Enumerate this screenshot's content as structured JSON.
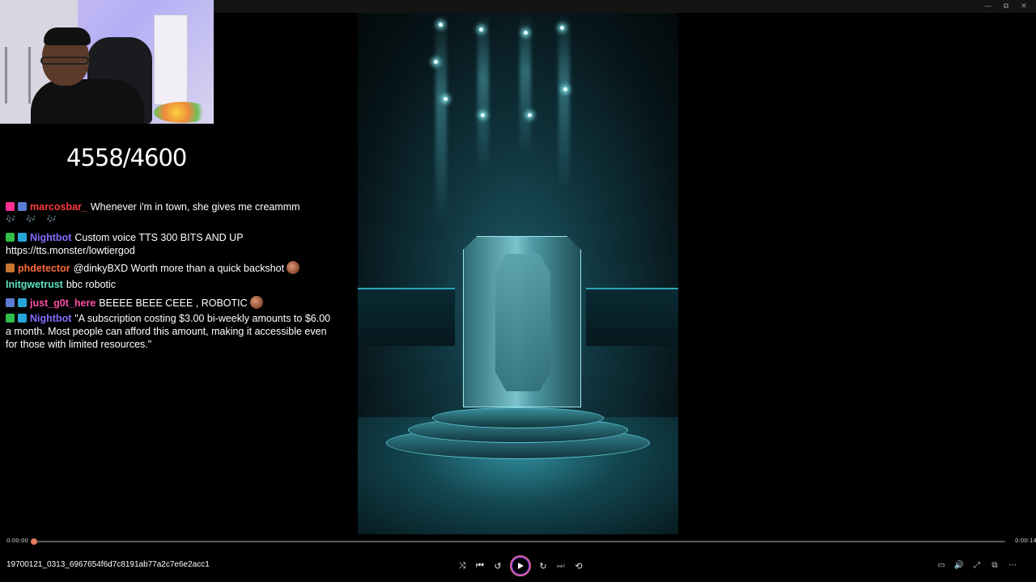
{
  "window": {
    "controls": [
      {
        "name": "minimize-button",
        "glyph": "—"
      },
      {
        "name": "restore-button",
        "glyph": "⧉"
      },
      {
        "name": "close-button",
        "glyph": "✕"
      }
    ]
  },
  "overlay": {
    "counter": "4558/4600"
  },
  "chat": {
    "messages": [
      {
        "user": "marcosbar_",
        "user_color": "#ff3b3b",
        "text": "Whenever i'm in town, she gives me creammm",
        "badges": [
          "#ff2f92",
          "#5b7bd6"
        ],
        "extra_line": "🎶 🎶 🎶"
      },
      {
        "user": "Nightbot",
        "user_color": "#8a6bff",
        "text": "Custom voice TTS 300 BITS AND UP https://tts.monster/lowtiergod",
        "badges": [
          "#2fbf4a",
          "#26a7d8"
        ]
      },
      {
        "user": "phdetector",
        "user_color": "#ff6b3b",
        "text": "@dinkyBXD Worth more than a quick backshot",
        "badges": [
          "#c8762f"
        ],
        "emote": true
      },
      {
        "user": "Initgwetrust",
        "user_color": "#5fe3c0",
        "text": "bbc robotic",
        "badges": []
      },
      {
        "user": "just_g0t_here",
        "user_color": "#ff4fa8",
        "text": "BEEEE BEEE CEEE , ROBOTIC",
        "badges": [
          "#5b7bd6",
          "#26a7d8"
        ],
        "emote": true
      },
      {
        "user": "Nightbot",
        "user_color": "#8a6bff",
        "text": "\"A subscription costing $3.00 bi-weekly amounts to $6.00 a month. Most people can afford this amount, making it accessible even for those with limited resources.\"",
        "badges": [
          "#2fbf4a",
          "#26a7d8"
        ]
      }
    ]
  },
  "player": {
    "current_time": "0:00:00",
    "total_time": "0:00:14",
    "progress_fraction": 0.002,
    "filename": "19700121_0313_6967654f6d7c8191ab77a2c7e6e2acc1",
    "controls": [
      {
        "name": "shuffle-button",
        "glyph": "⤨",
        "enabled": true
      },
      {
        "name": "previous-button",
        "glyph": "⏮",
        "enabled": true
      },
      {
        "name": "rewind-10-button",
        "glyph": "↺",
        "enabled": true
      },
      {
        "name": "play-button",
        "glyph": "▶",
        "enabled": true
      },
      {
        "name": "forward-30-button",
        "glyph": "↻",
        "enabled": true
      },
      {
        "name": "next-button",
        "glyph": "⏭",
        "enabled": false
      },
      {
        "name": "repeat-button",
        "glyph": "⟲",
        "enabled": true
      }
    ],
    "right_controls": [
      {
        "name": "captions-button",
        "glyph": "▭"
      },
      {
        "name": "volume-button",
        "glyph": "🔊"
      },
      {
        "name": "fullscreen-button",
        "glyph": "⤢"
      },
      {
        "name": "miniplayer-button",
        "glyph": "⧉"
      },
      {
        "name": "more-button",
        "glyph": "⋯"
      }
    ]
  }
}
